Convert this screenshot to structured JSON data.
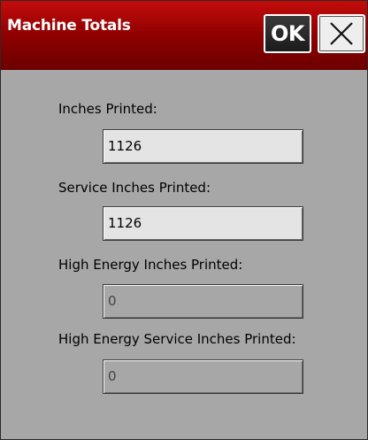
{
  "window": {
    "title": "Machine Totals",
    "ok_label": "OK"
  },
  "fields": [
    {
      "label": "Inches Printed:",
      "value": "1126",
      "enabled": true
    },
    {
      "label": "Service Inches Printed:",
      "value": "1126",
      "enabled": true
    },
    {
      "label": "High Energy Inches Printed:",
      "value": "0",
      "enabled": false
    },
    {
      "label": "High Energy Service Inches Printed:",
      "value": "0",
      "enabled": false
    }
  ],
  "colors": {
    "titlebar": "#a00000",
    "background": "#a7a7a7"
  }
}
